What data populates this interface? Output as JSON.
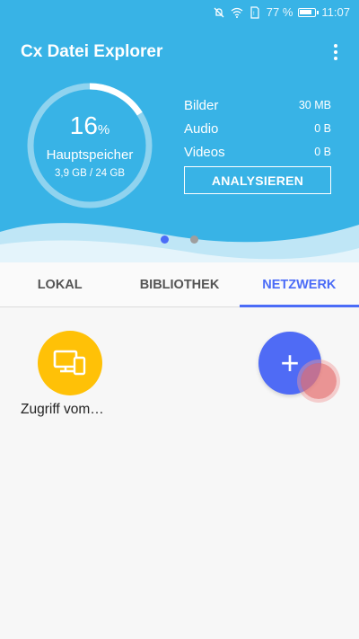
{
  "status_bar": {
    "battery": "77 %",
    "time": "11:07"
  },
  "header": {
    "title": "Cx Datei Explorer"
  },
  "storage": {
    "percent": "16",
    "percent_sign": "%",
    "label": "Hauptspeicher",
    "size": "3,9 GB / 24 GB",
    "fraction": 0.16
  },
  "stats": [
    {
      "label": "Bilder",
      "value": "30 MB"
    },
    {
      "label": "Audio",
      "value": "0 B"
    },
    {
      "label": "Videos",
      "value": "0 B"
    }
  ],
  "analyze_label": "ANALYSIEREN",
  "tabs": [
    {
      "label": "LOKAL",
      "active": false
    },
    {
      "label": "BIBLIOTHEK",
      "active": false
    },
    {
      "label": "NETZWERK",
      "active": true
    }
  ],
  "network_item": {
    "label": "Zugriff vom…"
  },
  "fab": {
    "symbol": "+"
  },
  "colors": {
    "header": "#38b3e6",
    "accent": "#4b6cf7",
    "tile": "#ffc107"
  }
}
